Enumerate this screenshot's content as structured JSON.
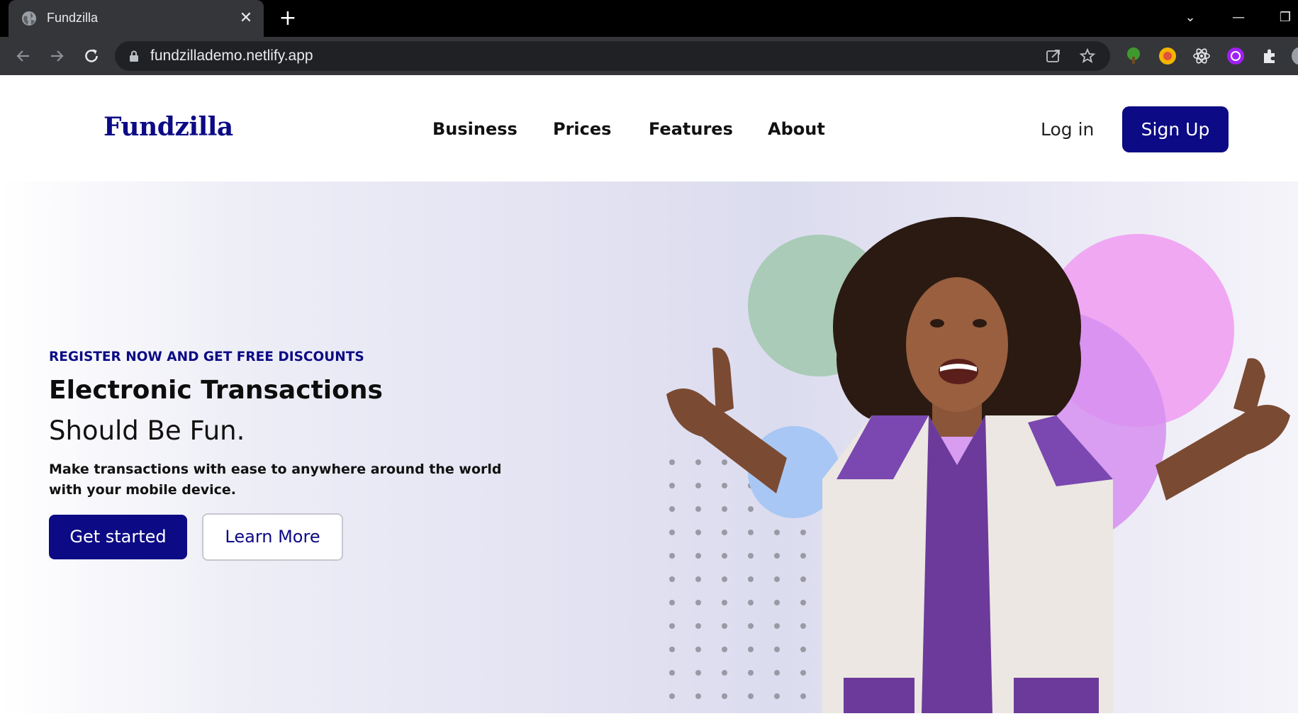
{
  "browser": {
    "tab_title": "Fundzilla",
    "url": "fundzillademo.netlify.app"
  },
  "site": {
    "logo": "Fundzilla",
    "nav": [
      "Business",
      "Prices",
      "Features",
      "About"
    ],
    "login": "Log in",
    "signup": "Sign Up"
  },
  "hero": {
    "kicker": "REGISTER NOW AND GET FREE DISCOUNTS",
    "headline": "Electronic Transactions",
    "subhead": "Should Be Fun.",
    "description": "Make transactions with ease to anywhere around the world with your mobile device.",
    "primary_cta": "Get started",
    "secondary_cta": "Learn More"
  },
  "colors": {
    "brand": "#0c0a84",
    "hero_bg": "#e2e2f2",
    "bubble_green": "#a9cbb7",
    "bubble_pink": "#f0a8f3",
    "bubble_purple": "#d68ff0",
    "bubble_yellow": "#eef0a2",
    "bubble_blue": "#a9c7f5"
  },
  "icons": {
    "tab_favicon": "globe-icon",
    "back": "arrow-left-icon",
    "forward": "arrow-right-icon",
    "reload": "reload-icon",
    "share": "share-icon",
    "bookmark": "star-icon",
    "extensions": "puzzle-icon"
  }
}
